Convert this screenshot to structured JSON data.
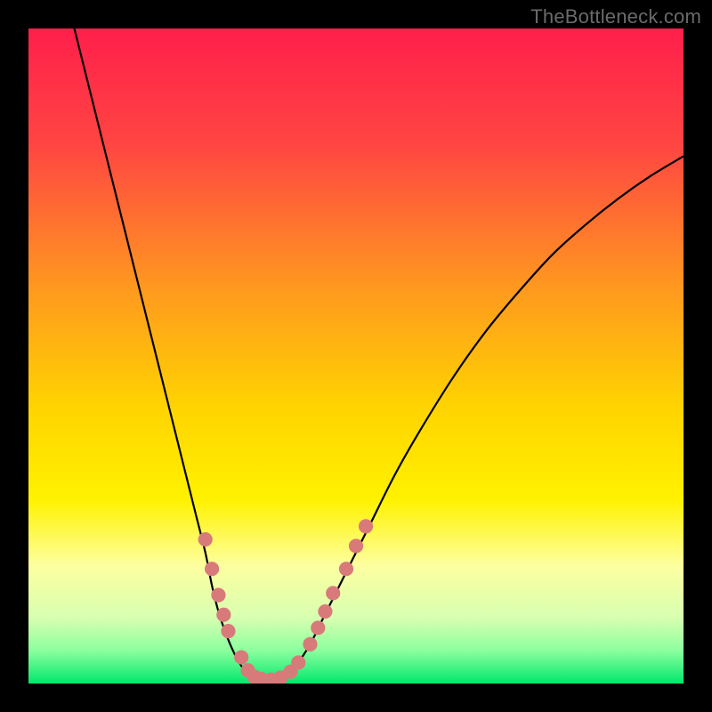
{
  "watermark": "TheBottleneck.com",
  "chart_data": {
    "type": "line",
    "title": "",
    "xlabel": "",
    "ylabel": "",
    "xlim": [
      0,
      100
    ],
    "ylim": [
      0,
      100
    ],
    "gradient_stops": [
      {
        "offset": 0.0,
        "color": "#ff1f4b"
      },
      {
        "offset": 0.18,
        "color": "#ff4642"
      },
      {
        "offset": 0.4,
        "color": "#ff9a1e"
      },
      {
        "offset": 0.58,
        "color": "#ffd400"
      },
      {
        "offset": 0.72,
        "color": "#fff200"
      },
      {
        "offset": 0.82,
        "color": "#fdffa0"
      },
      {
        "offset": 0.9,
        "color": "#d7ffb0"
      },
      {
        "offset": 0.95,
        "color": "#8bff9e"
      },
      {
        "offset": 1.0,
        "color": "#00e86b"
      }
    ],
    "series": [
      {
        "name": "left-branch",
        "x": [
          7,
          9,
          11,
          13,
          15,
          17,
          19,
          21,
          22.5,
          24,
          25.5,
          27,
          28,
          29,
          30,
          31,
          32,
          33,
          34
        ],
        "y": [
          100,
          92,
          84,
          76,
          68,
          60,
          52,
          44,
          38,
          32,
          26,
          20,
          15,
          11,
          8,
          5.5,
          3.5,
          2,
          1.2
        ]
      },
      {
        "name": "valley-floor",
        "x": [
          34,
          35,
          36,
          37,
          38,
          39
        ],
        "y": [
          1.2,
          0.8,
          0.6,
          0.6,
          0.8,
          1.2
        ]
      },
      {
        "name": "right-branch",
        "x": [
          39,
          41,
          43,
          45,
          48,
          52,
          56,
          60,
          65,
          70,
          75,
          80,
          85,
          90,
          95,
          100
        ],
        "y": [
          1.2,
          3,
          6,
          10,
          16,
          24,
          32,
          39,
          47,
          54,
          60,
          65.5,
          70,
          74,
          77.5,
          80.5
        ]
      }
    ],
    "markers": [
      {
        "x": 27.0,
        "y": 22.0
      },
      {
        "x": 28.0,
        "y": 17.5
      },
      {
        "x": 29.0,
        "y": 13.5
      },
      {
        "x": 29.8,
        "y": 10.5
      },
      {
        "x": 30.5,
        "y": 8.0
      },
      {
        "x": 32.5,
        "y": 4.0
      },
      {
        "x": 33.5,
        "y": 2.0
      },
      {
        "x": 34.5,
        "y": 1.0
      },
      {
        "x": 35.5,
        "y": 0.7
      },
      {
        "x": 37.0,
        "y": 0.6
      },
      {
        "x": 38.5,
        "y": 0.9
      },
      {
        "x": 40.0,
        "y": 1.8
      },
      {
        "x": 41.2,
        "y": 3.2
      },
      {
        "x": 43.0,
        "y": 6.0
      },
      {
        "x": 44.2,
        "y": 8.5
      },
      {
        "x": 45.3,
        "y": 11.0
      },
      {
        "x": 46.5,
        "y": 13.8
      },
      {
        "x": 48.5,
        "y": 17.5
      },
      {
        "x": 50.0,
        "y": 21.0
      },
      {
        "x": 51.5,
        "y": 24.0
      }
    ],
    "marker_radius": 1.1
  }
}
